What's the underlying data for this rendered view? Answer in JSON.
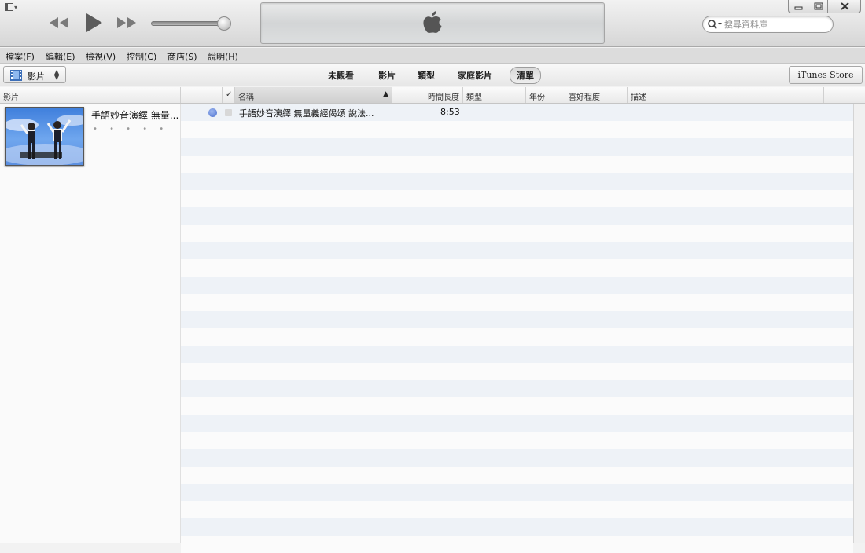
{
  "toolbar": {
    "search_placeholder": "搜尋資料庫"
  },
  "menu": [
    "檔案(F)",
    "編輯(E)",
    "檢視(V)",
    "控制(C)",
    "商店(S)",
    "說明(H)"
  ],
  "library": {
    "selected": "影片",
    "tabs": [
      "未觀看",
      "影片",
      "類型",
      "家庭影片",
      "清單"
    ],
    "active_tab": "清單",
    "store_button": "iTunes Store"
  },
  "columns": {
    "left_panel": "影片",
    "check": "✓",
    "name": "名稱",
    "time": "時間長度",
    "genre": "類型",
    "year": "年份",
    "rating": "喜好程度",
    "description": "描述"
  },
  "left_item": {
    "title": "手語妙音演繹 無量...",
    "rating_dots": "• • • • •",
    "thumb_caption": "手語妙音演繹"
  },
  "rows": [
    {
      "name": "手語妙音演繹 無量義經偈頌 說法...",
      "time": "8:53"
    }
  ]
}
